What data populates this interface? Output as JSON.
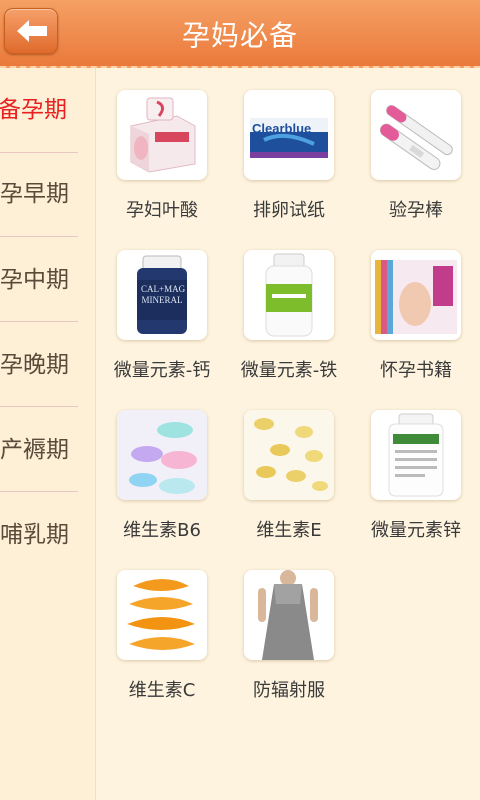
{
  "header": {
    "title": "孕妈必备",
    "back_icon": "back-arrow-icon"
  },
  "sidebar": {
    "items": [
      {
        "label": "备孕期",
        "active": true
      },
      {
        "label": "孕早期",
        "active": false
      },
      {
        "label": "孕中期",
        "active": false
      },
      {
        "label": "孕晚期",
        "active": false
      },
      {
        "label": "产褥期",
        "active": false
      },
      {
        "label": "哺乳期",
        "active": false
      }
    ]
  },
  "products": [
    {
      "label": "孕妇叶酸",
      "icon": "folic-acid-box-icon"
    },
    {
      "label": "排卵试纸",
      "icon": "clearblue-ovulation-test-icon",
      "brand_text": "Clearblue"
    },
    {
      "label": "验孕棒",
      "icon": "pregnancy-test-stick-icon"
    },
    {
      "label": "微量元素-钙",
      "icon": "calcium-bottle-icon",
      "bottle_text": "CAL+MAG MINERAL"
    },
    {
      "label": "微量元素-铁",
      "icon": "iron-bottle-icon"
    },
    {
      "label": "怀孕书籍",
      "icon": "pregnancy-books-icon"
    },
    {
      "label": "维生素B6",
      "icon": "vitamin-b6-pills-icon"
    },
    {
      "label": "维生素E",
      "icon": "vitamin-e-capsules-icon"
    },
    {
      "label": "微量元素锌",
      "icon": "zinc-bottle-icon"
    },
    {
      "label": "维生素C",
      "icon": "orange-slices-icon"
    },
    {
      "label": "防辐射服",
      "icon": "radiation-dress-icon"
    }
  ],
  "colors": {
    "header": "#ea7a3b",
    "active": "#e8201f",
    "background": "#fdf3df"
  }
}
